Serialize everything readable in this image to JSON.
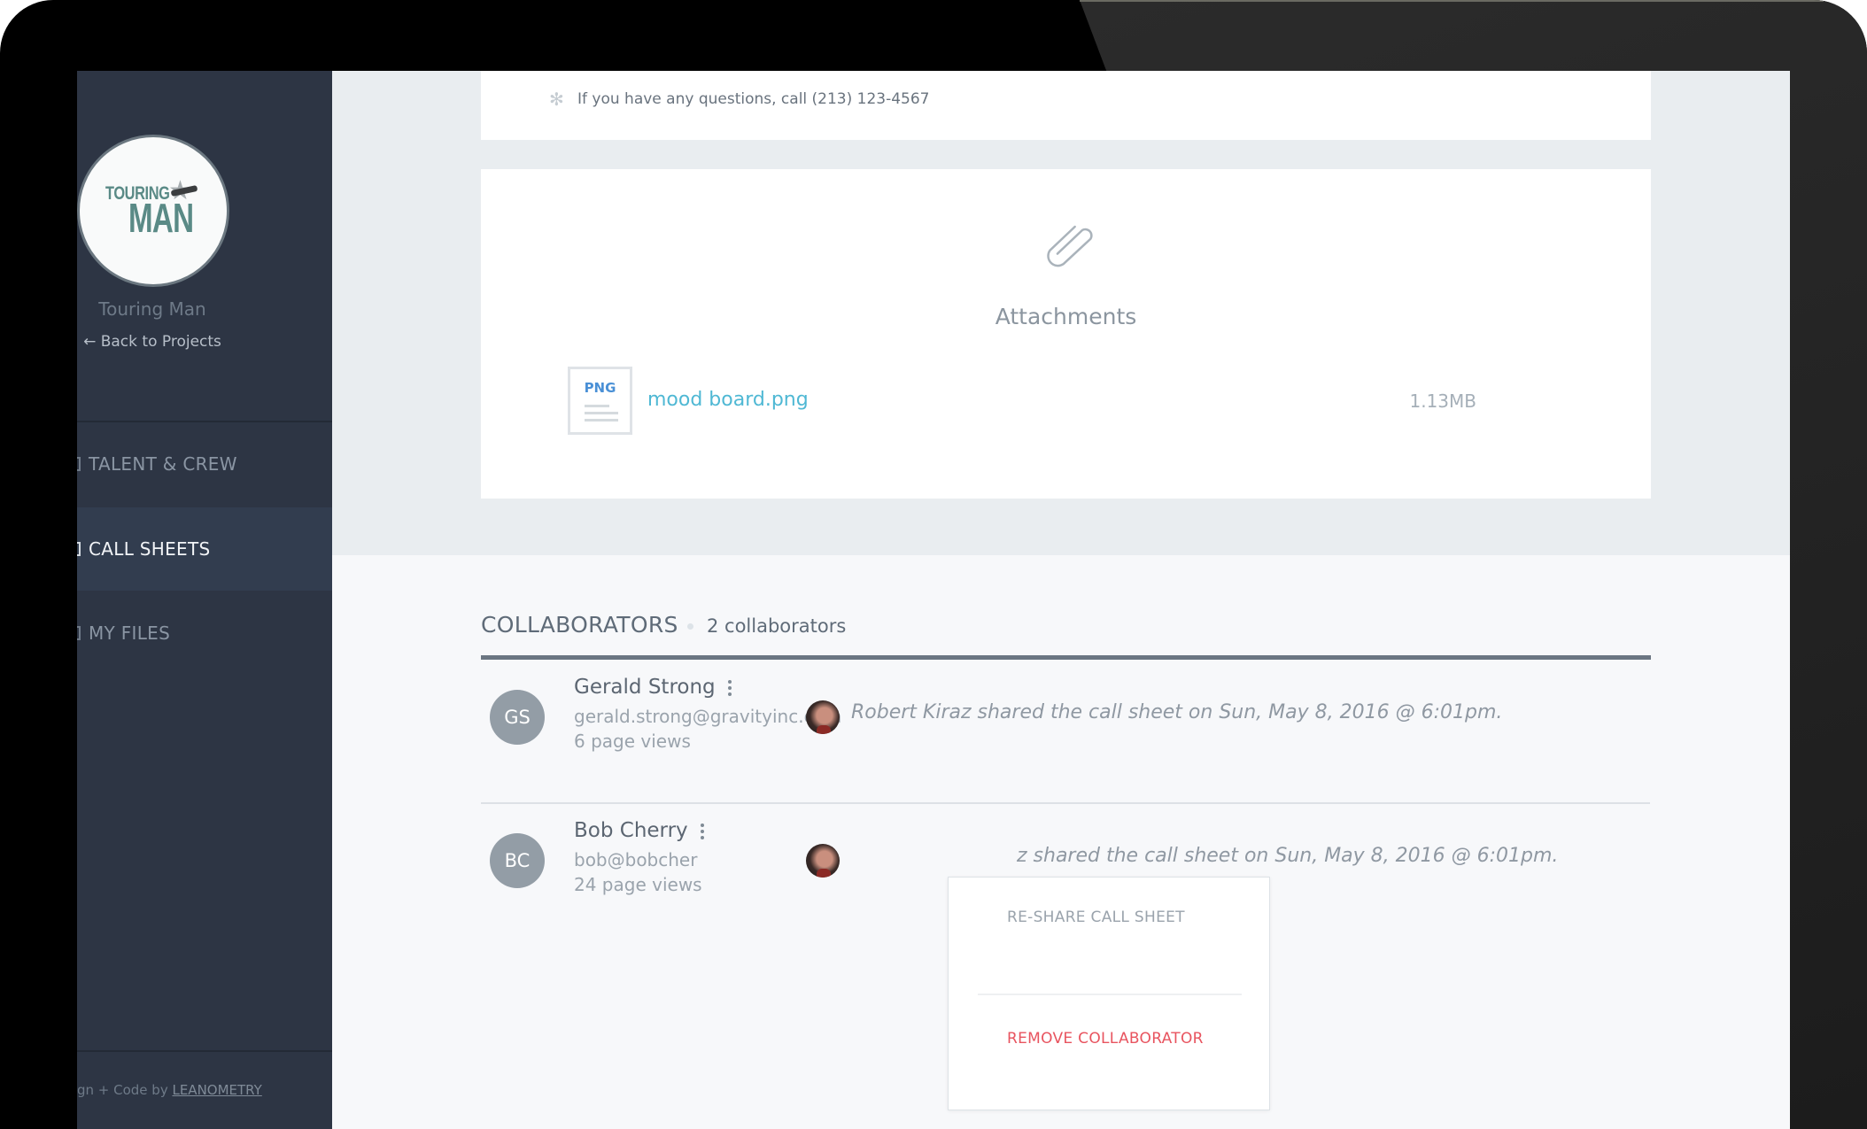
{
  "sidebar": {
    "logo": {
      "line1": "TOURING",
      "line2": "MAN",
      "star": "★"
    },
    "project_name": "Touring Man",
    "back_link": "← Back to Projects",
    "nav": [
      {
        "label": "TALENT & CREW",
        "icon": "users-icon",
        "active": false
      },
      {
        "label": "CALL SHEETS",
        "icon": "document-icon",
        "active": true
      },
      {
        "label": "MY FILES",
        "icon": "folder-icon",
        "active": false
      }
    ],
    "footer": {
      "text": "gn + Code by ",
      "link": "LEANOMETRY"
    }
  },
  "notes": {
    "icon": "asterisk-icon",
    "text": "If you have any questions, call (213) 123-4567"
  },
  "attachments": {
    "icon": "paperclip-icon",
    "title": "Attachments",
    "files": [
      {
        "type": "PNG",
        "name": "mood board.png",
        "size": "1.13MB"
      }
    ]
  },
  "collaborators": {
    "title": "COLLABORATORS",
    "count_label": "2 collaborators",
    "items": [
      {
        "initials": "GS",
        "name": "Gerald Strong",
        "email": "gerald.strong@gravityinc.com",
        "views": "6 page views",
        "shared": "Robert Kiraz shared the call sheet on Sun, May 8, 2016 @ 6:01pm."
      },
      {
        "initials": "BC",
        "name": "Bob Cherry",
        "email": "bob@bobcher",
        "views": "24 page views",
        "shared": "z shared the call sheet on Sun, May 8, 2016 @ 6:01pm."
      }
    ]
  },
  "dropdown": {
    "items": [
      {
        "label": "RE-SHARE CALL SHEET",
        "color": "#9aa3ac"
      },
      {
        "label": "REMOVE COLLABORATOR",
        "color": "#e8545f"
      }
    ]
  },
  "colors": {
    "sidebar_bg": "#2d3544",
    "sidebar_active": "#323d4f",
    "accent_link": "#4fb8d4",
    "danger": "#e8545f",
    "avatar_bg": "#939da6"
  }
}
